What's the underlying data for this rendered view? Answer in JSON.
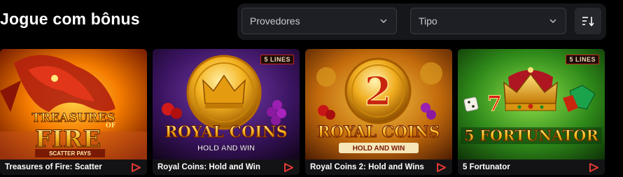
{
  "page": {
    "title": "Jogue com bônus"
  },
  "filters": {
    "providers": {
      "label": "Provedores"
    },
    "type": {
      "label": "Tipo"
    }
  },
  "cards": [
    {
      "caption": "Treasures of Fire: Scatter",
      "logo_top": "TREASURES",
      "logo_of": "OF",
      "logo_main": "FIRE",
      "logo_sub": "SCATTER PAYS"
    },
    {
      "caption": "Royal Coins: Hold and Win",
      "badge": "5 LINES",
      "logo_main": "ROYAL COINS",
      "logo_sub": "HOLD AND WIN"
    },
    {
      "caption": "Royal Coins 2: Hold and Wins",
      "digit": "2",
      "logo_main": "ROYAL COINS",
      "logo_sub": "HOLD AND WIN"
    },
    {
      "caption": "5 Fortunator",
      "badge": "5 LINES",
      "logo_main": "5 FORTUNATOR"
    }
  ],
  "colors": {
    "accent": "#e53935",
    "panel": "#16171b",
    "field": "#1e1f24"
  }
}
